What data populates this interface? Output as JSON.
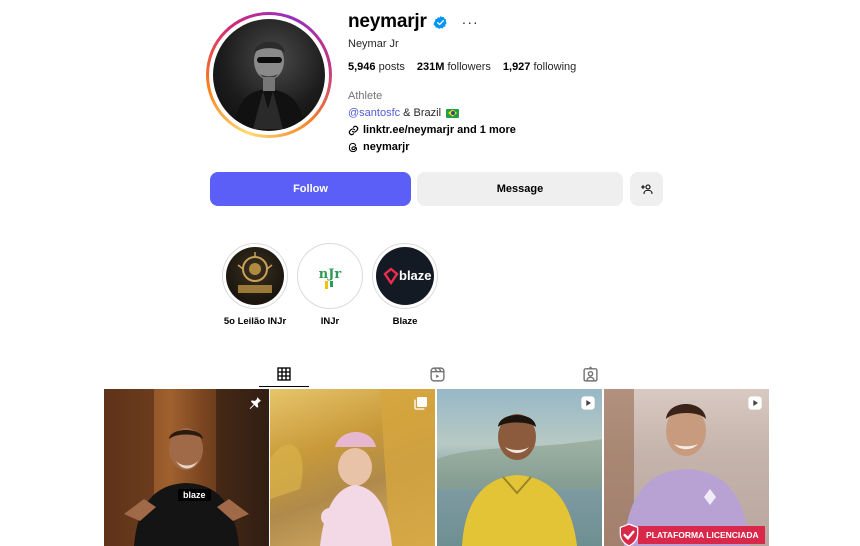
{
  "profile": {
    "username": "neymarjr",
    "full_name": "Neymar Jr",
    "more_options": "···",
    "stats": {
      "posts_count": "5,946",
      "posts_label": "posts",
      "followers_count": "231M",
      "followers_label": "followers",
      "following_count": "1,927",
      "following_label": "following"
    },
    "category": "Athlete",
    "bio_mention": "@santosfc",
    "bio_rest": "& Brazil",
    "link_text": "linktr.ee/neymarjr and 1 more",
    "threads_handle": "neymarjr"
  },
  "buttons": {
    "follow": "Follow",
    "message": "Message"
  },
  "highlights": [
    {
      "label": "5o Leilão INJr"
    },
    {
      "label": "INJr"
    },
    {
      "label": "Blaze"
    }
  ],
  "highlight_art": {
    "blaze_text": "blaze",
    "injr_text": "nJr"
  },
  "tabs": [
    {
      "icon": "grid-icon",
      "active": true
    },
    {
      "icon": "reels-icon",
      "active": false
    },
    {
      "icon": "tagged-icon",
      "active": false
    }
  ],
  "posts": [
    {
      "badge": "pin-icon",
      "overlay_text": "blaze"
    },
    {
      "badge": "carousel-icon",
      "overlay_text": ""
    },
    {
      "badge": "reel-icon",
      "overlay_text": ""
    },
    {
      "badge": "reel-icon",
      "overlay_text": "PLATAFORMA LICENCIADA"
    }
  ],
  "colors": {
    "follow_button": "#5b5ef7",
    "secondary_button": "#efefef",
    "verified_badge": "#0095f6",
    "mention_link": "#4f5bd5"
  }
}
